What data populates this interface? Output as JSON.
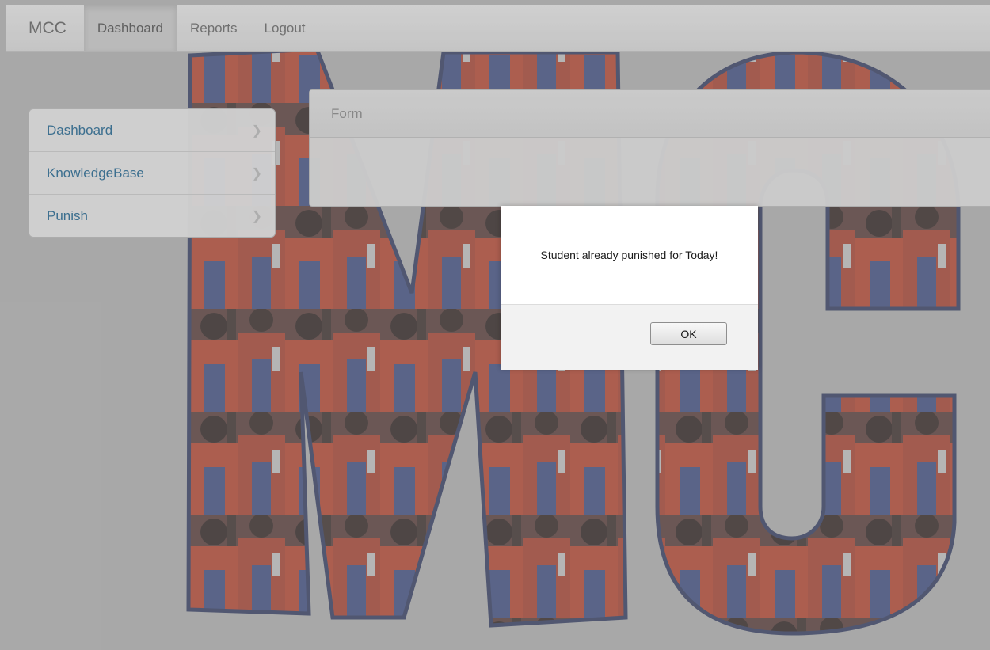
{
  "navbar": {
    "brand": "MCC",
    "items": [
      {
        "label": "Dashboard",
        "active": true
      },
      {
        "label": "Reports",
        "active": false
      },
      {
        "label": "Logout",
        "active": false
      }
    ]
  },
  "sidebar": {
    "items": [
      {
        "label": "Dashboard",
        "icon": "chevron-right-icon"
      },
      {
        "label": "KnowledgeBase",
        "icon": "chevron-right-icon"
      },
      {
        "label": "Punish",
        "icon": "chevron-right-icon"
      }
    ]
  },
  "panel": {
    "heading": "Form"
  },
  "dialog": {
    "message": "Student already punished for Today!",
    "ok_label": "OK"
  },
  "colors": {
    "link": "#2f6d94",
    "jacket_red": "#c8452c",
    "jacket_blue": "#3e4f8c",
    "letter_outline": "#2e3a66"
  }
}
